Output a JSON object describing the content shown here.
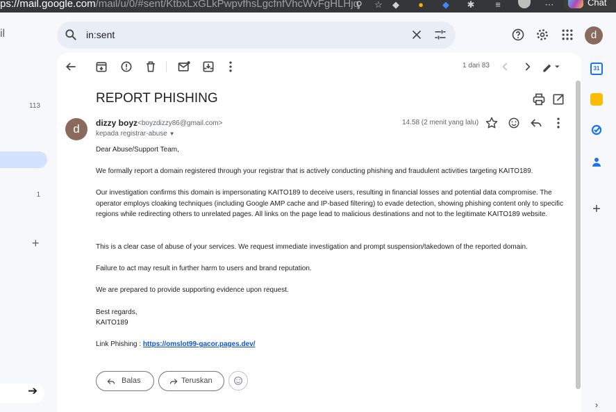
{
  "browser": {
    "url_host": "ps://mail.google.com",
    "url_rest": "/mail/u/0/#sent/KtbxLxGLkPwpvfhsLgcfnfVhcWvFgHLHjq",
    "chat_label": "Chat"
  },
  "nav": {
    "app_letter": "il",
    "count_inbox": "113",
    "count_other": "1"
  },
  "search": {
    "value": "in:sent"
  },
  "user": {
    "initial": "d"
  },
  "toolbar": {
    "pager": "1 dari 83"
  },
  "email": {
    "subject": "REPORT PHISHING",
    "sender_initial": "d",
    "sender_name": "dizzy boyz",
    "sender_email": "<boyzdizzy86@gmail.com>",
    "to": "kepada registrar-abuse",
    "time": "14.58 (2 menit yang lalu)",
    "body": [
      "Dear Abuse/Support Team,",
      "We formally report a domain registered through your registrar that is actively conducting phishing and fraudulent activities targeting KAITO189.",
      "Our investigation confirms this domain is impersonating KAITO189 to deceive users, resulting in financial losses and potential data compromise. The operator employs cloaking techniques (including Google AMP cache and IP-based filtering) to evade detection, showing phishing content only to specific regions while redirecting others to unrelated pages. All links on the page lead to malicious destinations and not to the legitimate KAITO189  website.",
      "This is a clear case of abuse of your services. We request immediate investigation and prompt suspension/takedown of the reported domain.",
      "Failure to act may result in further harm to users and brand reputation.",
      "We are prepared to provide supporting evidence upon request.",
      "Best regards,",
      "KAITO189"
    ],
    "link_label": "Link Phishing : ",
    "link_url": "https://omslot99-gacor.pages.dev/"
  },
  "actions": {
    "reply": "Balas",
    "forward": "Teruskan"
  },
  "side_panel": {
    "calendar_day": "31"
  },
  "colors": {
    "accent": "#1a73e8",
    "link": "#1155cc",
    "avatar": "#8a6a5c"
  }
}
